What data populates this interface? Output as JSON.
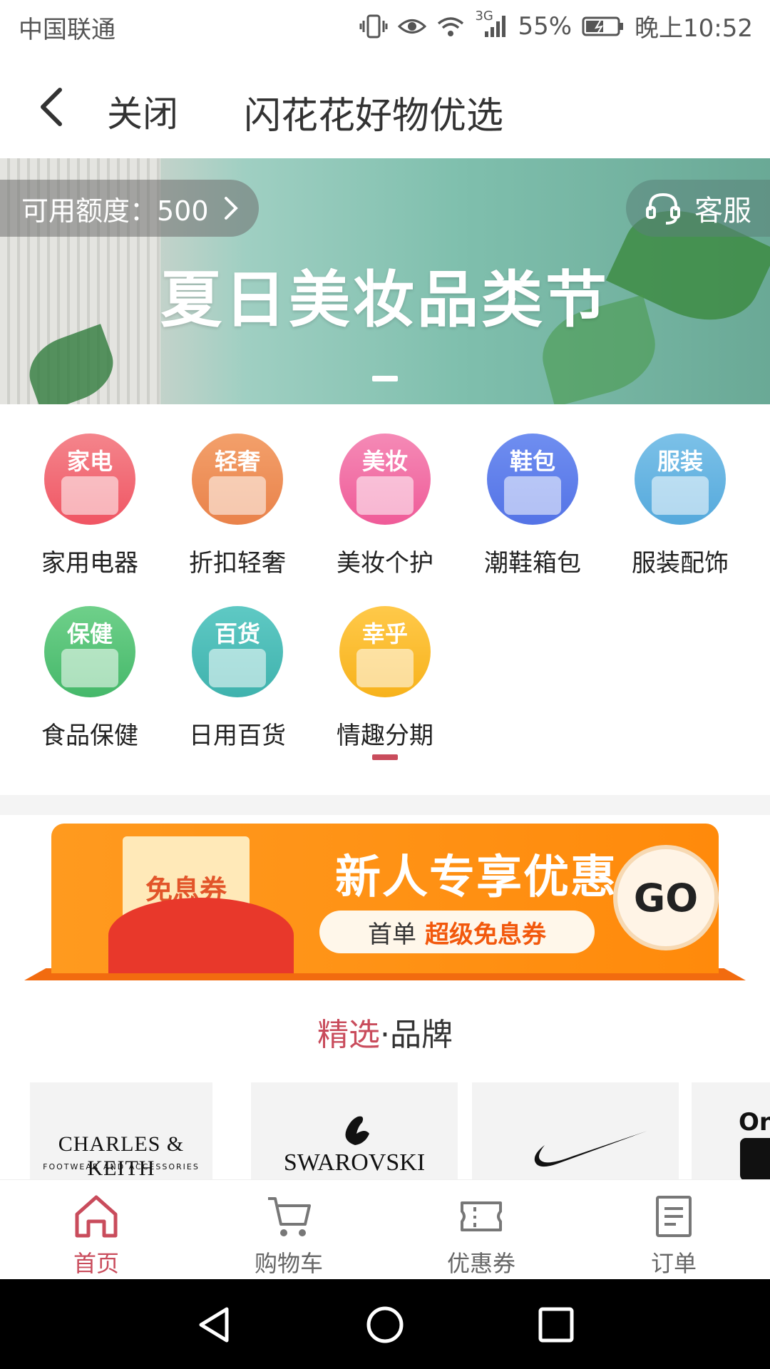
{
  "status_bar": {
    "carrier": "中国联通",
    "network": "3G",
    "battery": "55%",
    "time": "晚上10:52"
  },
  "title_bar": {
    "close_label": "关闭",
    "title": "闪花花好物优选"
  },
  "banner": {
    "credit_label": "可用额度：500",
    "service_label": "客服",
    "title": "夏日美妆品类节"
  },
  "categories": [
    {
      "badge": "家电",
      "label": "家用电器",
      "color_top": "#f4858c",
      "color_bottom": "#f05563"
    },
    {
      "badge": "轻奢",
      "label": "折扣轻奢",
      "color_top": "#f3a06b",
      "color_bottom": "#e9824a"
    },
    {
      "badge": "美妆",
      "label": "美妆个护",
      "color_top": "#f58ab6",
      "color_bottom": "#ef5b98"
    },
    {
      "badge": "鞋包",
      "label": "潮鞋箱包",
      "color_top": "#6f8ef0",
      "color_bottom": "#5473e6"
    },
    {
      "badge": "服装",
      "label": "服装配饰",
      "color_top": "#7cc1e8",
      "color_bottom": "#55a9dc"
    },
    {
      "badge": "保健",
      "label": "食品保健",
      "color_top": "#6fd08a",
      "color_bottom": "#45b86a"
    },
    {
      "badge": "百货",
      "label": "日用百货",
      "color_top": "#5fc9c4",
      "color_bottom": "#3fb2ad"
    },
    {
      "badge": "幸乎",
      "label": "情趣分期",
      "color_top": "#ffc94a",
      "color_bottom": "#f7b21b"
    }
  ],
  "promo": {
    "envelope_text": "免息券",
    "heading": "新人专享优惠",
    "sub_plain": "首单",
    "sub_highlight": "超级免息券",
    "go_label": "GO"
  },
  "brands": {
    "heading_highlight": "精选",
    "heading_rest": "·品牌",
    "items": [
      {
        "name": "CHARLES & KEITH",
        "tagline": "FOOTWEAR AND ACCESSORIES"
      },
      {
        "name": "SWAROVSKI"
      },
      {
        "name": "Nike"
      },
      {
        "name": "On"
      }
    ]
  },
  "bottom_nav": [
    {
      "label": "首页",
      "icon": "home-icon",
      "active": true
    },
    {
      "label": "购物车",
      "icon": "cart-icon",
      "active": false
    },
    {
      "label": "优惠券",
      "icon": "coupon-icon",
      "active": false
    },
    {
      "label": "订单",
      "icon": "order-icon",
      "active": false
    }
  ],
  "colors": {
    "accent": "#c94c5c",
    "promo_orange": "#ff8a0b"
  }
}
